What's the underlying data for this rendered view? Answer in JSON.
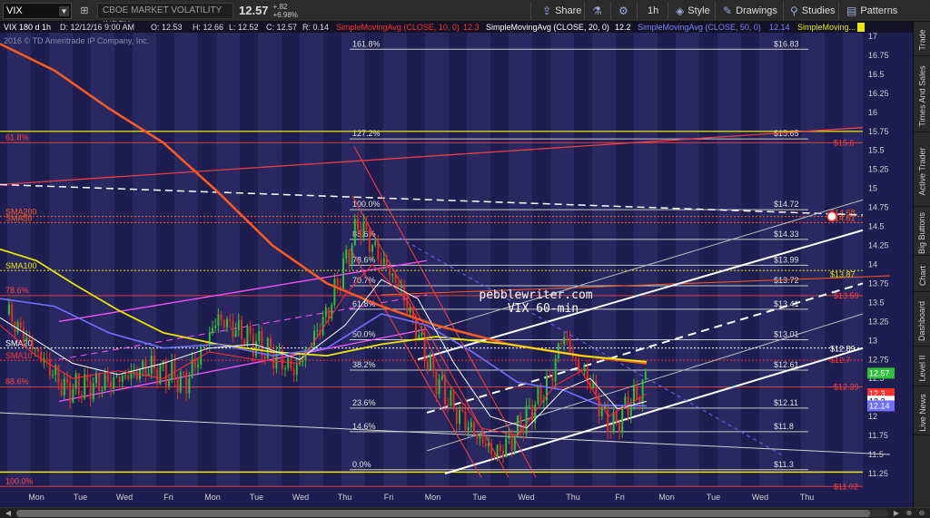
{
  "toolbar": {
    "symbol": "VIX",
    "description": "CBOE MARKET VOLATILITY INDEX",
    "last_price": "12.57",
    "change": "+.82",
    "change_pct": "+6.98%",
    "share_label": "Share",
    "period_label": "1h",
    "style_label": "Style",
    "drawings_label": "Drawings",
    "studies_label": "Studies",
    "patterns_label": "Patterns"
  },
  "infobar": {
    "chart_settings": "VIX 180 d 1h",
    "date": "D: 12/12/16 9:00 AM",
    "open": "O: 12.53",
    "high": "H: 12.66",
    "low": "L: 12.52",
    "close": "C: 12.57",
    "range": "R: 0.14",
    "sma10": "SimpleMovingAvg (CLOSE, 10, 0)",
    "sma10_val": "12.3",
    "sma20": "SimpleMovingAvg (CLOSE, 20, 0)",
    "sma20_val": "12.2",
    "sma50": "SimpleMovingAvg (CLOSE, 50, 0)",
    "sma50_val": "12.14",
    "sma_more": "SimpleMoving..."
  },
  "copyright": "2016 © TD Ameritrade IP Company, Inc.",
  "watermark": {
    "line1": "pebblewriter.com",
    "line2": "VIX 60-min"
  },
  "colors": {
    "background": "#1e1d50",
    "stripe": "#2d2c66",
    "up_candle": "#2fbf3a",
    "down_candle": "#e03020",
    "sma10": "#ff3030",
    "sma20": "#ffffff",
    "sma50": "#7070ff",
    "sma100": "#e8e800",
    "sma200": "#ff5a1f",
    "fib_left": "#ff4040",
    "channel_pink": "#ff55ff",
    "price_badge": "#2fbf3a",
    "sma10_badge": "#ff3030",
    "sma50_badge": "#7070ff"
  },
  "chart_data": {
    "type": "candlestick",
    "y_axis": {
      "min": 11.25,
      "max": 17,
      "ticks": [
        "17",
        "16.75",
        "16.5",
        "16.25",
        "16",
        "15.75",
        "15.5",
        "15.25",
        "15",
        "14.75",
        "14.5",
        "14.25",
        "14",
        "13.75",
        "13.5",
        "13.25",
        "13",
        "12.75",
        "12.5",
        "12.25",
        "12",
        "11.75",
        "11.5",
        "11.25"
      ]
    },
    "x_axis": {
      "labels": [
        "Mon",
        "Tue",
        "Wed",
        "Fri",
        "Mon",
        "Tue",
        "Wed",
        "Thu",
        "Fri",
        "Mon",
        "Tue",
        "Wed",
        "Thu",
        "Fri",
        "Mon",
        "Tue",
        "Wed",
        "Thu"
      ]
    },
    "fib_right": [
      {
        "label": "161.8%",
        "value": "$16.83",
        "y": 16.83
      },
      {
        "label": "127.2%",
        "value": "$15.65",
        "y": 15.65
      },
      {
        "label": "100.0%",
        "value": "$14.72",
        "y": 14.72
      },
      {
        "label": "88.6%",
        "value": "$14.33",
        "y": 14.33
      },
      {
        "label": "78.6%",
        "value": "$13.99",
        "y": 13.99
      },
      {
        "label": "70.7%",
        "value": "$13.72",
        "y": 13.72
      },
      {
        "label": "61.8%",
        "value": "$13.41",
        "y": 13.41
      },
      {
        "label": "50.0%",
        "value": "$13.01",
        "y": 13.01
      },
      {
        "label": "38.2%",
        "value": "$12.61",
        "y": 12.61
      },
      {
        "label": "23.6%",
        "value": "$12.11",
        "y": 12.11
      },
      {
        "label": "14.6%",
        "value": "$11.8",
        "y": 11.8
      },
      {
        "label": "0.0%",
        "value": "$11.3",
        "y": 11.3
      }
    ],
    "fib_left": [
      {
        "label": "61.8%",
        "value": "$15.6",
        "y": 15.6
      },
      {
        "label": "78.6%",
        "value": "$13.59",
        "y": 13.59
      },
      {
        "label": "88.6%",
        "value": "$12.39",
        "y": 12.39
      },
      {
        "label": "100.0%",
        "value": "$11.02",
        "y": 11.08
      }
    ],
    "sma_labels": [
      {
        "label": "SMA200",
        "y": 14.63,
        "color": "#ff5a1f"
      },
      {
        "label": "SMA50",
        "y": 14.55,
        "color": "#ff5a1f"
      },
      {
        "label": "SMA100",
        "y": 13.92,
        "color": "#e8e800"
      },
      {
        "label": "SMA20",
        "y": 12.9,
        "color": "#ffffff"
      },
      {
        "label": "SMA10",
        "y": 12.74,
        "color": "#ff3030"
      }
    ],
    "right_values": [
      {
        "value": "$14.68",
        "y": 14.68,
        "color": "#ff5a1f"
      },
      {
        "value": "$14.61",
        "y": 14.61,
        "color": "#ff5a1f"
      },
      {
        "value": "$13.87",
        "y": 13.87,
        "color": "#e8e800"
      },
      {
        "value": "$12.89",
        "y": 12.89,
        "color": "#ffffff"
      },
      {
        "value": "$12.7",
        "y": 12.74,
        "color": "#ff3030"
      }
    ],
    "price_badges": [
      {
        "value": "12.57",
        "y": 12.57,
        "color": "#2fbf3a"
      },
      {
        "value": "12.3",
        "y": 12.3,
        "color": "#ff3030"
      },
      {
        "value": "12.2",
        "y": 12.2,
        "color": "#ffffff"
      },
      {
        "value": "12.14",
        "y": 12.14,
        "color": "#7070ff"
      }
    ]
  },
  "side_panel": {
    "tabs": [
      "Trade",
      "Times And Sales",
      "Active Trader",
      "Big Buttons",
      "Chart",
      "Dashboard",
      "Level II",
      "Live News"
    ]
  }
}
